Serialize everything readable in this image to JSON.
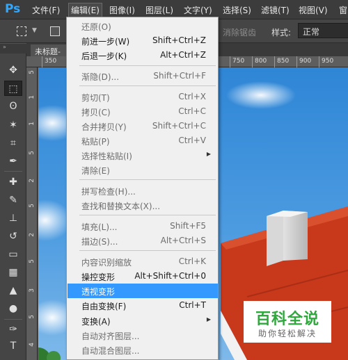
{
  "app": {
    "logo": "Ps"
  },
  "menubar": {
    "items": [
      "文件(F)",
      "编辑(E)",
      "图像(I)",
      "图层(L)",
      "文字(Y)",
      "选择(S)",
      "滤镜(T)",
      "视图(V)",
      "窗"
    ]
  },
  "options": {
    "antialias": "消除锯齿",
    "style_label": "样式:",
    "style_value": "正常"
  },
  "document": {
    "tab_title": "未标题-",
    "ruler_top": [
      "350",
      "750",
      "800",
      "850",
      "900",
      "950"
    ],
    "ruler_left": [
      "5",
      "1",
      "1",
      "5",
      "2",
      "5",
      "2",
      "5",
      "3",
      "5",
      "4"
    ]
  },
  "edit_menu": {
    "items": [
      {
        "label": "还原(O)",
        "shortcut": "",
        "enabled": false
      },
      {
        "label": "前进一步(W)",
        "shortcut": "Shift+Ctrl+Z",
        "enabled": true
      },
      {
        "label": "后退一步(K)",
        "shortcut": "Alt+Ctrl+Z",
        "enabled": true
      },
      {
        "label": "渐隐(D)...",
        "shortcut": "Shift+Ctrl+F",
        "enabled": false
      },
      {
        "label": "剪切(T)",
        "shortcut": "Ctrl+X",
        "enabled": false
      },
      {
        "label": "拷贝(C)",
        "shortcut": "Ctrl+C",
        "enabled": false
      },
      {
        "label": "合并拷贝(Y)",
        "shortcut": "Shift+Ctrl+C",
        "enabled": false
      },
      {
        "label": "粘贴(P)",
        "shortcut": "Ctrl+V",
        "enabled": false
      },
      {
        "label": "选择性粘贴(I)",
        "shortcut": "",
        "enabled": false,
        "submenu": true
      },
      {
        "label": "清除(E)",
        "shortcut": "",
        "enabled": false
      },
      {
        "label": "拼写检查(H)...",
        "shortcut": "",
        "enabled": false
      },
      {
        "label": "查找和替换文本(X)...",
        "shortcut": "",
        "enabled": false
      },
      {
        "label": "填充(L)...",
        "shortcut": "Shift+F5",
        "enabled": false
      },
      {
        "label": "描边(S)...",
        "shortcut": "Alt+Ctrl+S",
        "enabled": false
      },
      {
        "label": "内容识别缩放",
        "shortcut": "Ctrl+K",
        "enabled": false
      },
      {
        "label": "操控变形",
        "shortcut": "Alt+Shift+Ctrl+0",
        "enabled": true
      },
      {
        "label": "透视变形",
        "shortcut": "",
        "enabled": true,
        "highlighted": true
      },
      {
        "label": "自由变换(F)",
        "shortcut": "Ctrl+T",
        "enabled": true
      },
      {
        "label": "变换(A)",
        "shortcut": "",
        "enabled": true,
        "submenu": true
      },
      {
        "label": "自动对齐图层...",
        "shortcut": "",
        "enabled": false
      },
      {
        "label": "自动混合图层...",
        "shortcut": "",
        "enabled": false
      }
    ]
  },
  "watermark": {
    "title": "百科全说",
    "subtitle": "助你轻松解决"
  },
  "colors": {
    "highlight": "#3399ff",
    "menu_bg": "#f0f0f0",
    "watermark_green": "#2fa73d",
    "roof": "#c8381b",
    "sky": "#3d8fd8"
  },
  "icons": [
    "move-icon",
    "marquee-icon",
    "lasso-icon",
    "magic-wand-icon",
    "crop-icon",
    "eyedropper-icon",
    "healing-brush-icon",
    "brush-icon",
    "clone-stamp-icon",
    "history-brush-icon",
    "eraser-icon",
    "gradient-icon",
    "blur-icon",
    "dodge-icon",
    "pen-icon",
    "type-icon"
  ]
}
